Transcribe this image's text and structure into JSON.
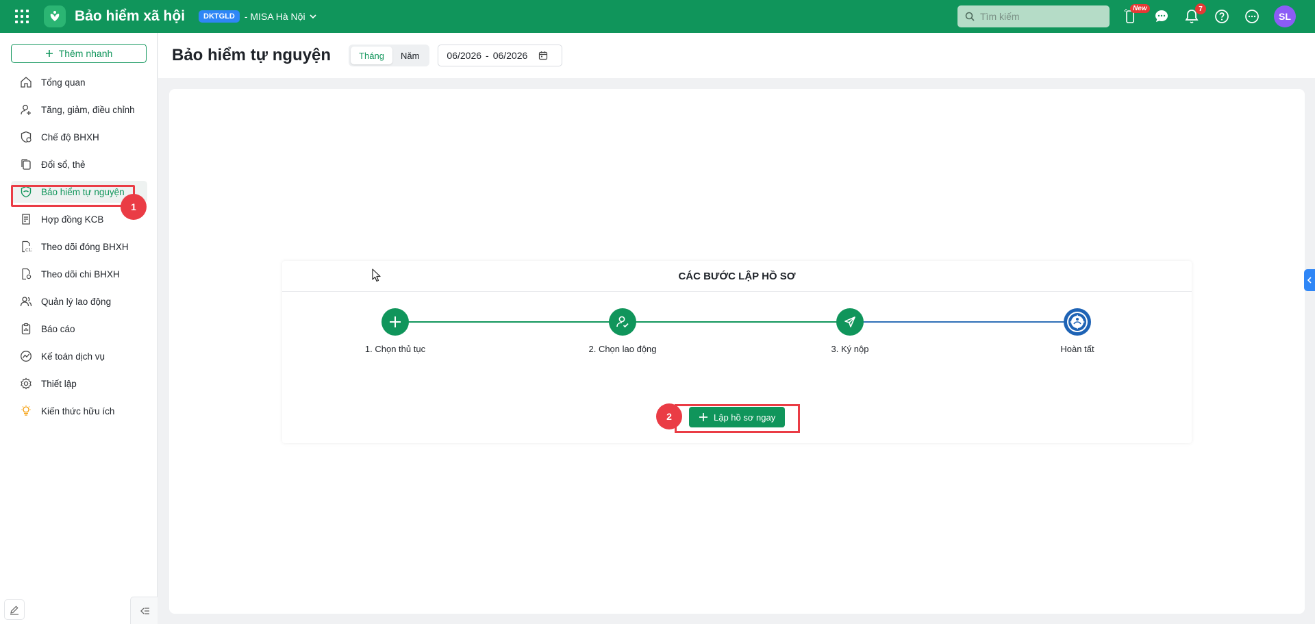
{
  "header": {
    "app_title": "Bảo hiểm xã hội",
    "tenant_badge": "DKTGLD",
    "tenant_name": "- MISA Hà Nội",
    "search_placeholder": "Tìm kiếm",
    "new_badge": "New",
    "notification_count": "7",
    "avatar_initials": "SL",
    "brand_color": "#10955b"
  },
  "sidebar": {
    "quick_add_label": "Thêm nhanh",
    "items": [
      {
        "label": "Tổng quan",
        "icon": "home-icon"
      },
      {
        "label": "Tăng, giảm, điều chỉnh",
        "icon": "user-plus-icon"
      },
      {
        "label": "Chế độ BHXH",
        "icon": "shield-heart-icon"
      },
      {
        "label": "Đổi sổ, thẻ",
        "icon": "copy-icon"
      },
      {
        "label": "Bảo hiểm tự nguyện",
        "icon": "shield-check-icon",
        "active": true
      },
      {
        "label": "Hợp đồng KCB",
        "icon": "contract-icon"
      },
      {
        "label": "Theo dõi đóng BHXH",
        "icon": "c12-icon"
      },
      {
        "label": "Theo dõi chi BHXH",
        "icon": "doc-settings-icon"
      },
      {
        "label": "Quản lý lao động",
        "icon": "users-icon"
      },
      {
        "label": "Báo cáo",
        "icon": "clipboard-icon"
      },
      {
        "label": "Kế toán dịch vụ",
        "icon": "chart-circle-icon"
      },
      {
        "label": "Thiết lập",
        "icon": "gear-icon"
      },
      {
        "label": "Kiến thức hữu ích",
        "icon": "idea-icon"
      }
    ]
  },
  "page": {
    "title": "Bảo hiểm tự nguyện",
    "period_toggle": [
      "Tháng",
      "Năm"
    ],
    "selected_period": "Tháng",
    "date_from": "06/2026",
    "date_separator": "-",
    "date_to": "06/2026"
  },
  "steps_panel": {
    "title": "CÁC BƯỚC LẬP HỒ SƠ",
    "steps": [
      "1. Chọn thủ tục",
      "2. Chọn lao động",
      "3. Ký nộp",
      "Hoàn tất"
    ],
    "cta_label": "Lập hồ sơ ngay"
  },
  "annotations": {
    "marker_1": "1",
    "marker_2": "2",
    "highlight_color": "#ea3c45"
  }
}
